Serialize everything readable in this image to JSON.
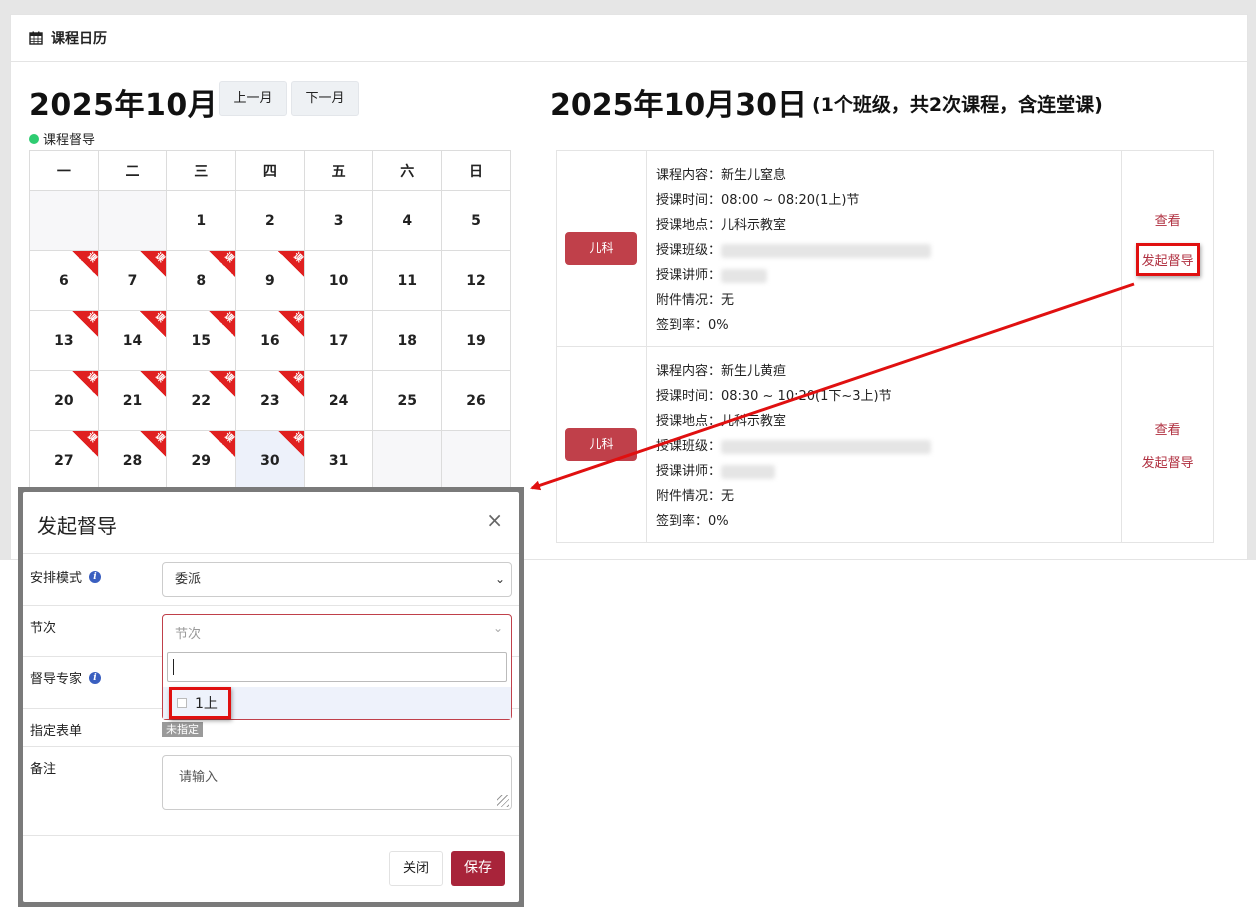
{
  "card": {
    "title": "课程日历"
  },
  "calendar": {
    "month_title": "2025年10月",
    "prev_label": "上一月",
    "next_label": "下一月",
    "legend_label": "课程督导",
    "legend_color": "#2ecc71",
    "weekdays": [
      "一",
      "二",
      "三",
      "四",
      "五",
      "六",
      "日"
    ],
    "ribbon_text": "课",
    "weeks": [
      [
        {
          "d": ""
        },
        {
          "d": ""
        },
        {
          "d": "1"
        },
        {
          "d": "2"
        },
        {
          "d": "3"
        },
        {
          "d": "4"
        },
        {
          "d": "5"
        }
      ],
      [
        {
          "d": "6",
          "r": true
        },
        {
          "d": "7",
          "r": true
        },
        {
          "d": "8",
          "r": true
        },
        {
          "d": "9",
          "r": true
        },
        {
          "d": "10"
        },
        {
          "d": "11"
        },
        {
          "d": "12"
        }
      ],
      [
        {
          "d": "13",
          "r": true
        },
        {
          "d": "14",
          "r": true
        },
        {
          "d": "15",
          "r": true
        },
        {
          "d": "16",
          "r": true
        },
        {
          "d": "17"
        },
        {
          "d": "18"
        },
        {
          "d": "19"
        }
      ],
      [
        {
          "d": "20",
          "r": true
        },
        {
          "d": "21",
          "r": true
        },
        {
          "d": "22",
          "r": true
        },
        {
          "d": "23",
          "r": true
        },
        {
          "d": "24"
        },
        {
          "d": "25"
        },
        {
          "d": "26"
        }
      ],
      [
        {
          "d": "27",
          "r": true
        },
        {
          "d": "28",
          "r": true
        },
        {
          "d": "29",
          "r": true
        },
        {
          "d": "30",
          "r": true,
          "today": true
        },
        {
          "d": "31"
        },
        {
          "d": ""
        },
        {
          "d": ""
        }
      ]
    ]
  },
  "day": {
    "title": "2025年10月30日",
    "subtitle": "(1个班级，共2次课程，含连堂课)",
    "sessions": [
      {
        "dept": "儿科",
        "content": "课程内容：新生儿窒息",
        "time": "授课时间：08:00 ~ 08:20(1上)节",
        "location": "授课地点：儿科示教室",
        "class_label": "授课班级：",
        "teacher_label": "授课讲师：",
        "attachment": "附件情况：无",
        "attendance": "签到率：0%",
        "view_label": "查看",
        "supervise_label": "发起督导"
      },
      {
        "dept": "儿科",
        "content": "课程内容：新生儿黄疸",
        "time": "授课时间：08:30 ~ 10:20(1下~3上)节",
        "location": "授课地点：儿科示教室",
        "class_label": "授课班级：",
        "teacher_label": "授课讲师：",
        "attachment": "附件情况：无",
        "attendance": "签到率：0%",
        "view_label": "查看",
        "supervise_label": "发起督导"
      }
    ]
  },
  "modal": {
    "title": "发起督导",
    "close_icon": "×",
    "mode_label": "安排模式",
    "mode_value": "委派",
    "section_label": "节次",
    "section_placeholder": "节次",
    "section_option": "1上",
    "expert_label": "督导专家",
    "form_label": "指定表单",
    "form_value": "未指定",
    "remark_label": "备注",
    "remark_placeholder": "请输入",
    "close_button": "关闭",
    "save_button": "保存"
  },
  "colors": {
    "accent": "#a8243a",
    "badge": "#c0404a",
    "link": "#b03040",
    "annotation": "#e01010"
  }
}
